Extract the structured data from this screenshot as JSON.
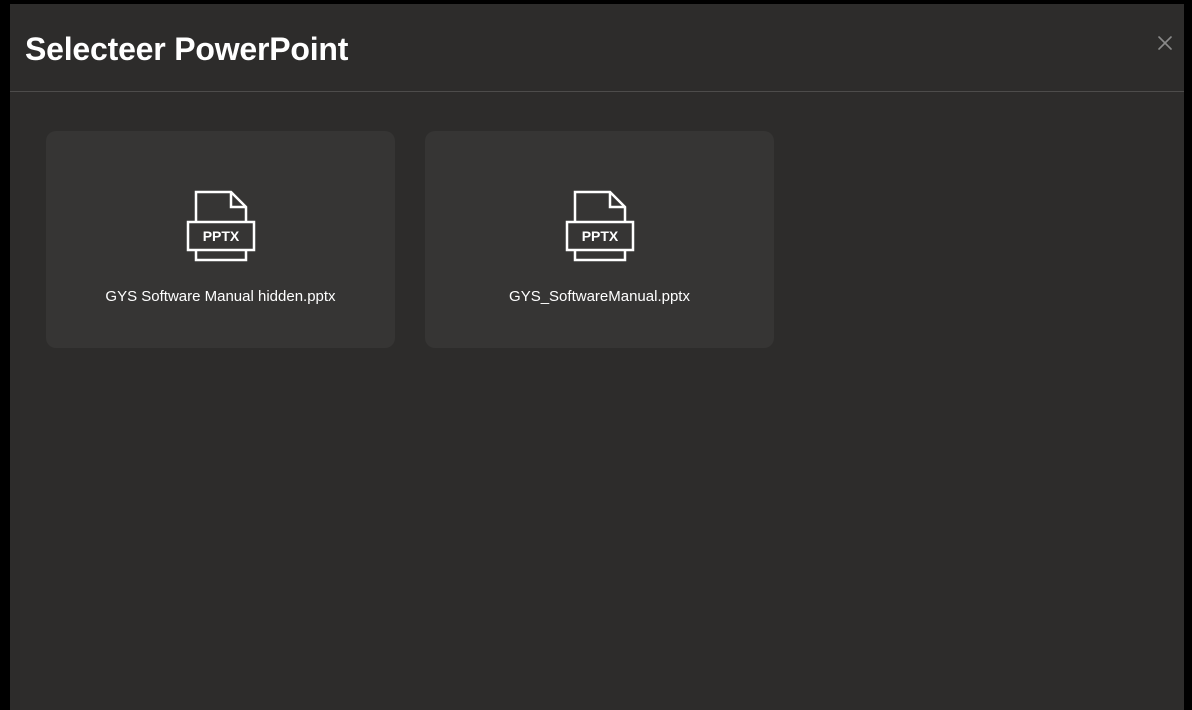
{
  "dialog": {
    "title": "Selecteer PowerPoint",
    "close_icon": "close-icon"
  },
  "files": [
    {
      "name": "GYS Software Manual hidden.pptx",
      "badge": "PPTX",
      "icon": "pptx-file-icon"
    },
    {
      "name": "GYS_SoftwareManual.pptx",
      "badge": "PPTX",
      "icon": "pptx-file-icon"
    }
  ],
  "colors": {
    "background": "#000000",
    "dialog": "#2d2c2b",
    "card": "#363534",
    "divider": "#4d4c4b",
    "text": "#ffffff",
    "close_icon": "#8a8a8a"
  }
}
